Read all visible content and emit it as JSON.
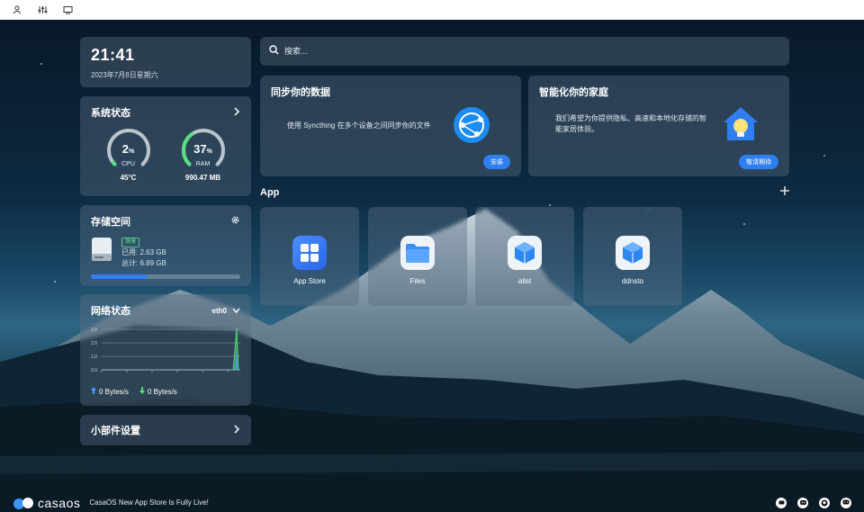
{
  "topbar": {
    "icons": [
      "user-icon",
      "sliders-icon",
      "screen-icon"
    ]
  },
  "clock": {
    "time": "21:41",
    "date": "2023年7月8日星期六"
  },
  "system_status": {
    "title": "系统状态",
    "cpu": {
      "percent": 2,
      "unit": "%",
      "label": "CPU",
      "sub": "45°C"
    },
    "ram": {
      "percent": 37,
      "unit": "%",
      "label": "RAM",
      "sub": "990.47 MB"
    }
  },
  "storage": {
    "title": "存储空间",
    "badge": "健康",
    "used": "已用: 2.63 GB",
    "total": "总计: 6.89 GB",
    "used_fraction": 0.38
  },
  "network": {
    "title": "网络状态",
    "interface": "eth0",
    "y_ticks": [
      "3.0",
      "2.0",
      "1.0",
      "0.0"
    ],
    "upload": "0 Bytes/s",
    "download": "0 Bytes/s"
  },
  "widget_settings": {
    "label": "小部件设置"
  },
  "search": {
    "placeholder": "搜索..."
  },
  "cards": [
    {
      "title": "同步你的数据",
      "desc": "使用 Syncthing 在多个设备之间同步你的文件",
      "button": "安装"
    },
    {
      "title": "智能化你的家庭",
      "desc_line1": "我们希望为你提供隐私、高速和本地化存储的智",
      "desc_line2": "能家居体验。",
      "button": "敬请期待"
    }
  ],
  "apps": {
    "title": "App",
    "items": [
      {
        "name": "App Store"
      },
      {
        "name": "Files"
      },
      {
        "name": "alist"
      },
      {
        "name": "ddnsto"
      }
    ]
  },
  "footer": {
    "logo": "casaos",
    "message": "CasaOS New App Store Is Fully Live!"
  },
  "colors": {
    "accent": "#2f7ff0",
    "gauge_green": "#58e07f",
    "healthy": "#51d18a"
  }
}
